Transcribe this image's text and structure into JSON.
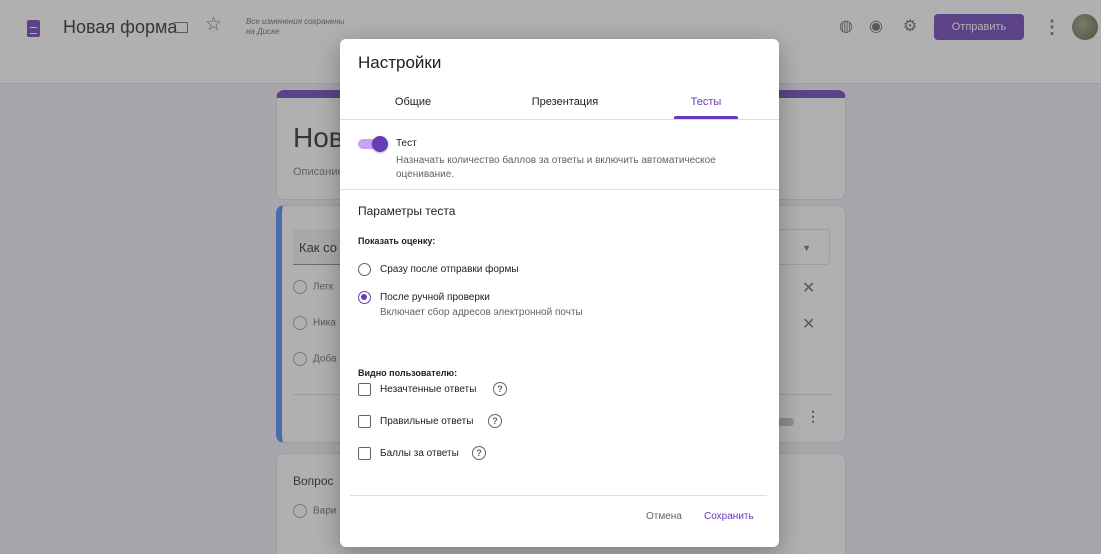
{
  "topbar": {
    "form_title": "Новая форма",
    "saved_note": "Все изменения сохранены на Диске",
    "send_label": "Отправить",
    "icons": [
      "doc-icon",
      "folder-icon",
      "star-icon",
      "palette-icon",
      "eye-icon",
      "gear-icon",
      "more-icon"
    ]
  },
  "background_form": {
    "title": "Нова",
    "description": "Описание",
    "question_text": "Как со",
    "options": [
      "Легк",
      "Ника",
      "Доба"
    ],
    "question2_title": "Вопрос",
    "question2_option": "Вари"
  },
  "dialog": {
    "title": "Настройки",
    "tabs": [
      {
        "label": "Общие",
        "active": false
      },
      {
        "label": "Презентация",
        "active": false
      },
      {
        "label": "Тесты",
        "active": true
      }
    ],
    "test_toggle": {
      "label": "Тест",
      "description": "Назначать количество баллов за ответы и включить автоматическое оценивание.",
      "on": true
    },
    "section_title": "Параметры теста",
    "show_grade": {
      "label": "Показать оценку:",
      "options": [
        {
          "label": "Сразу после отправки формы",
          "selected": false
        },
        {
          "label": "После ручной проверки",
          "sub": "Включает сбор адресов электронной почты",
          "selected": true
        }
      ]
    },
    "visible": {
      "label": "Видно пользователю:",
      "options": [
        {
          "label": "Незачтенные ответы",
          "checked": false
        },
        {
          "label": "Правильные ответы",
          "checked": false
        },
        {
          "label": "Баллы за ответы",
          "checked": false
        }
      ]
    },
    "cancel_label": "Отмена",
    "save_label": "Сохранить"
  },
  "colors": {
    "accent": "#673ab7",
    "background": "#f0ebf8"
  }
}
